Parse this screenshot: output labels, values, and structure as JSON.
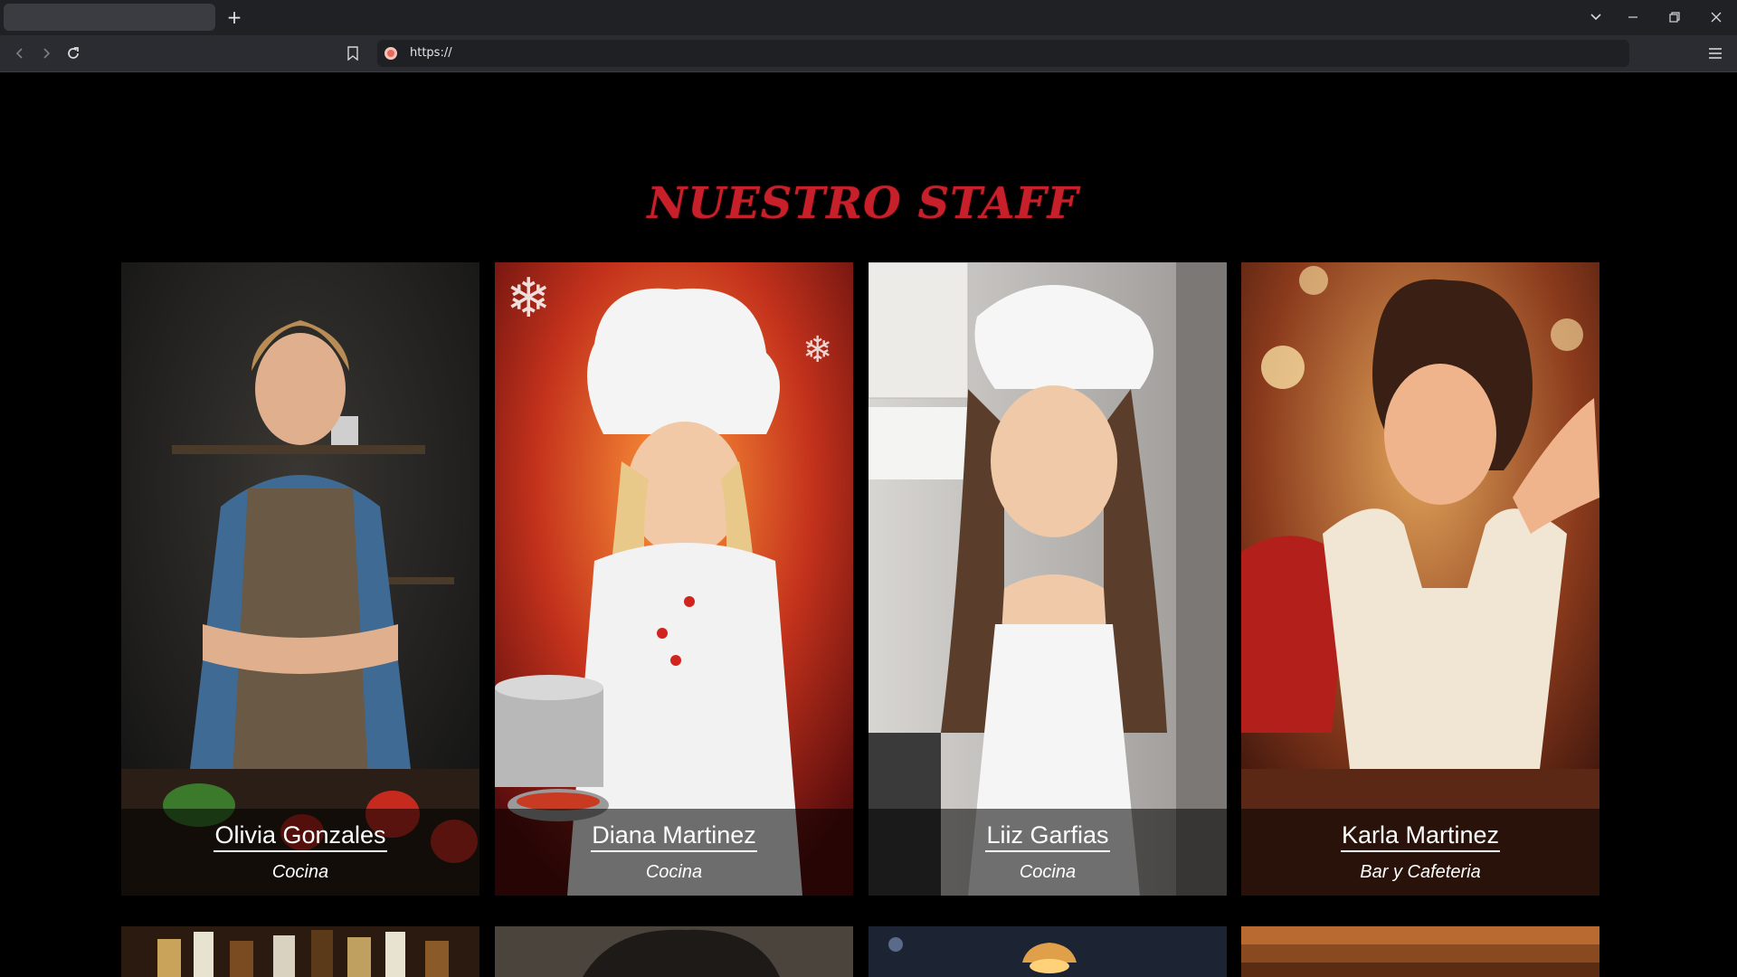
{
  "browser": {
    "url": "https://",
    "new_tab_label": "+",
    "icons": {
      "back": "back-arrow-icon",
      "forward": "forward-arrow-icon",
      "reload": "reload-icon",
      "bookmark": "bookmark-icon",
      "menu": "hamburger-menu-icon",
      "tab_list": "chevron-down-icon",
      "minimize": "minimize-icon",
      "restore": "restore-icon",
      "close": "close-icon"
    }
  },
  "section": {
    "title": "NUESTRO STAFF",
    "title_color": "#c8202a"
  },
  "staff": [
    {
      "name": "Olivia Gonzales",
      "role": "Cocina"
    },
    {
      "name": "Diana Martinez",
      "role": "Cocina"
    },
    {
      "name": "Liiz Garfias",
      "role": "Cocina"
    },
    {
      "name": "Karla Martinez",
      "role": "Bar y Cafeteria"
    }
  ]
}
